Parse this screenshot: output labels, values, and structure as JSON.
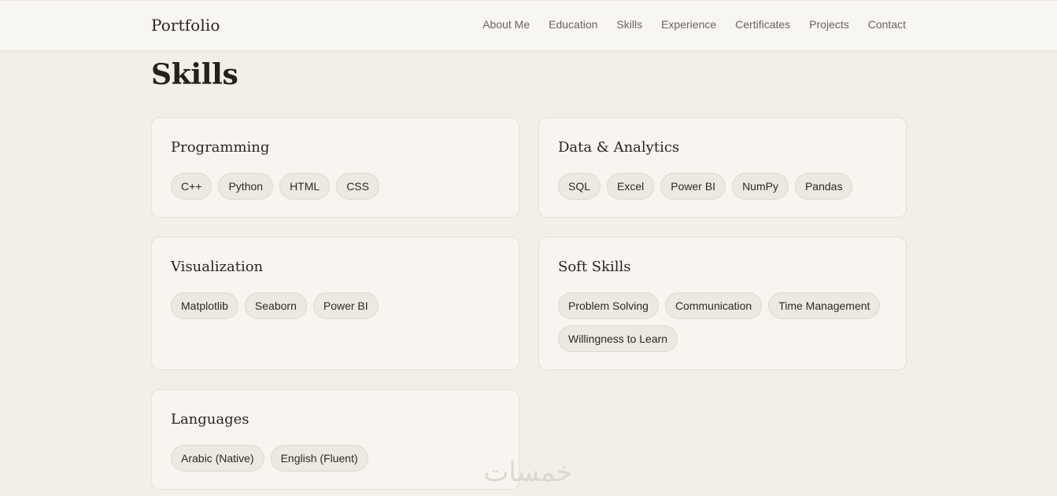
{
  "header": {
    "brand": "Portfolio",
    "nav": [
      "About Me",
      "Education",
      "Skills",
      "Experience",
      "Certificates",
      "Projects",
      "Contact"
    ]
  },
  "page": {
    "title": "Skills"
  },
  "cards": {
    "programming": {
      "title": "Programming",
      "chips": [
        "C++",
        "Python",
        "HTML",
        "CSS"
      ]
    },
    "data": {
      "title": "Data & Analytics",
      "chips": [
        "SQL",
        "Excel",
        "Power BI",
        "NumPy",
        "Pandas"
      ]
    },
    "visualization": {
      "title": "Visualization",
      "chips": [
        "Matplotlib",
        "Seaborn",
        "Power BI"
      ]
    },
    "soft": {
      "title": "Soft Skills",
      "chips": [
        "Problem Solving",
        "Communication",
        "Time Management",
        "Willingness to Learn"
      ]
    },
    "languages": {
      "title": "Languages",
      "chips": [
        "Arabic (Native)",
        "English (Fluent)"
      ]
    }
  },
  "watermark": {
    "text": "خمسات"
  }
}
